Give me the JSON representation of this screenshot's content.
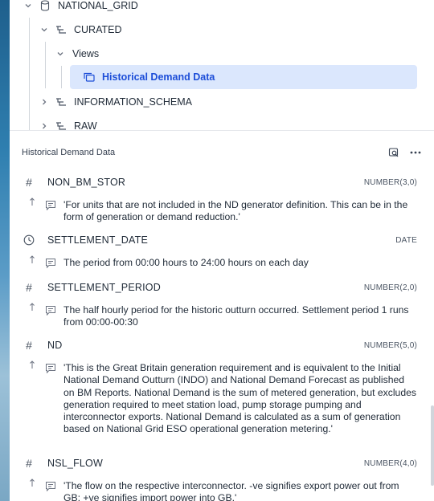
{
  "tree": {
    "database": "NATIONAL_GRID",
    "schema_curated": "CURATED",
    "folder_views": "Views",
    "selected_view": "Historical Demand Data",
    "schema_information": "INFORMATION_SCHEMA",
    "schema_raw": "RAW"
  },
  "detail": {
    "title": "Historical Demand Data",
    "columns": [
      {
        "name": "NON_BM_STOR",
        "type": "NUMBER(3,0)",
        "type_icon": "hash-icon",
        "description": "'For units that are not included in the ND generator definition. This can be in the form of generation or demand reduction.'"
      },
      {
        "name": "SETTLEMENT_DATE",
        "type": "DATE",
        "type_icon": "clock-icon",
        "description": "The period from 00:00 hours to 24:00 hours on each day"
      },
      {
        "name": "SETTLEMENT_PERIOD",
        "type": "NUMBER(2,0)",
        "type_icon": "hash-icon",
        "description": "The half hourly period for the historic outturn occurred. Settlement period 1 runs from 00:00-00:30"
      },
      {
        "name": "ND",
        "type": "NUMBER(5,0)",
        "type_icon": "hash-icon",
        "description": "'This is the Great Britain generation requirement and is equivalent to the Initial National Demand Outturn (INDO) and National Demand Forecast as published on BM Reports. National Demand is the sum of metered generation, but excludes generation required to meet station load, pump storage pumping and interconnector exports. National Demand is calculated as a sum of generation based on National Grid ESO operational generation metering.'"
      },
      {
        "name": "NSL_FLOW",
        "type": "NUMBER(4,0)",
        "type_icon": "hash-icon",
        "description": "'The flow on the respective interconnector. -ve signifies export power out from GB; +ve signifies import power into GB.'"
      }
    ]
  },
  "colors": {
    "selected_bg": "#dbe7fd",
    "selected_text": "#1d4ed8"
  }
}
